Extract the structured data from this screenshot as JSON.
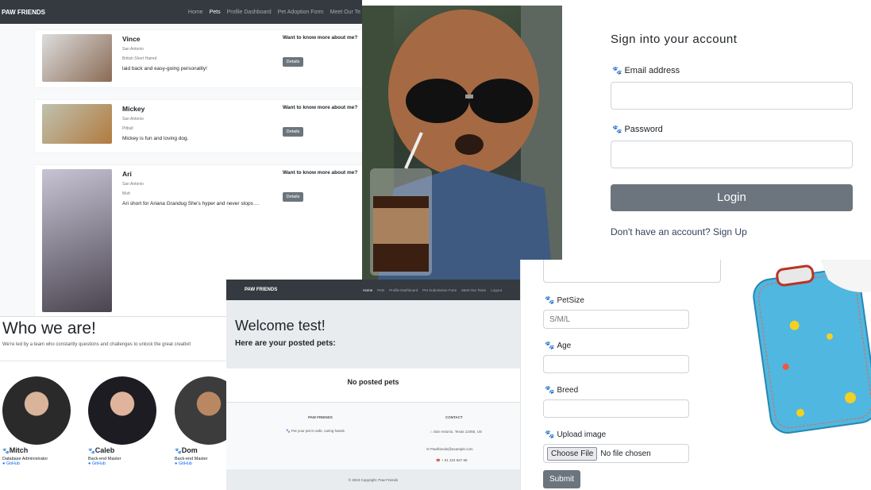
{
  "pets_page": {
    "brand": "PAW FRIENDS",
    "nav": [
      "Home",
      "Pets",
      "Profile Dashboard",
      "Pet Adoption Form",
      "Meet Our Te"
    ],
    "nav_active": 1,
    "cards": [
      {
        "name": "Vince",
        "city": "San Antonio",
        "breed": "British Short Haired",
        "desc": "laid back and easy-going personality!",
        "cta": "Want to know more about me?",
        "button": "Details"
      },
      {
        "name": "Mickey",
        "city": "San Antonio",
        "breed": "Pitbull",
        "desc": "Mickey is fun and loving dog.",
        "cta": "Want to know more about me?",
        "button": "Details"
      },
      {
        "name": "Ari",
        "city": "San Antonio",
        "breed": "Mutt",
        "desc": "Ari short for Ariana Grandug She's hyper and never stops ...",
        "cta": "Want to know more about me?",
        "button": "Details"
      }
    ]
  },
  "team": {
    "title": "Who we are!",
    "subtitle": "We're led by a team who constantly questions and challenges to unlock the great creativit",
    "members": [
      {
        "name": "Mitch",
        "role": "Database Administrator",
        "link": "GitHub"
      },
      {
        "name": "Caleb",
        "role": "Back-end Master",
        "link": "GitHub"
      },
      {
        "name": "Dom",
        "role": "Back-end Master",
        "link": "GitHub"
      }
    ]
  },
  "dashboard": {
    "brand": "PAW FRIENDS",
    "nav": [
      "Home",
      "Pets",
      "Profile Dashboard",
      "Pet Submission Form",
      "Meet Our Team",
      "Logout"
    ],
    "nav_active": 0,
    "welcome": "Welcome test!",
    "subheading": "Here are your posted pets:",
    "empty": "No posted pets",
    "footer": {
      "col1_title": "PAW FRIENDS",
      "col1_text": "Put your pet in safe, caring hands",
      "col2_title": "CONTACT",
      "address": "San Antonio, Texas 12465, US",
      "email": "Pawfriends@example.com",
      "phone": "+ 01 234 567 88",
      "copyright": "© 2023 Copyright: Paw Friends"
    }
  },
  "login": {
    "title": "Sign into your account",
    "email_label": "Email address",
    "password_label": "Password",
    "button": "Login",
    "signup": "Don't have an account? Sign Up"
  },
  "pet_form": {
    "petsize_label": "PetSize",
    "petsize_placeholder": "S/M/L",
    "age_label": "Age",
    "breed_label": "Breed",
    "upload_label": "Upload image",
    "choose_file": "Choose File",
    "no_file": "No file chosen",
    "submit": "Submit"
  },
  "icons": {
    "paw": "paw-icon",
    "github": "github-icon",
    "email": "envelope-icon",
    "phone": "phone-icon",
    "home": "home-icon"
  },
  "colors": {
    "navbar": "#343a40",
    "button": "#6c757d",
    "link": "#0d6efd",
    "page_bg": "#f8f9fa",
    "hero_bg": "#e9ecef"
  }
}
